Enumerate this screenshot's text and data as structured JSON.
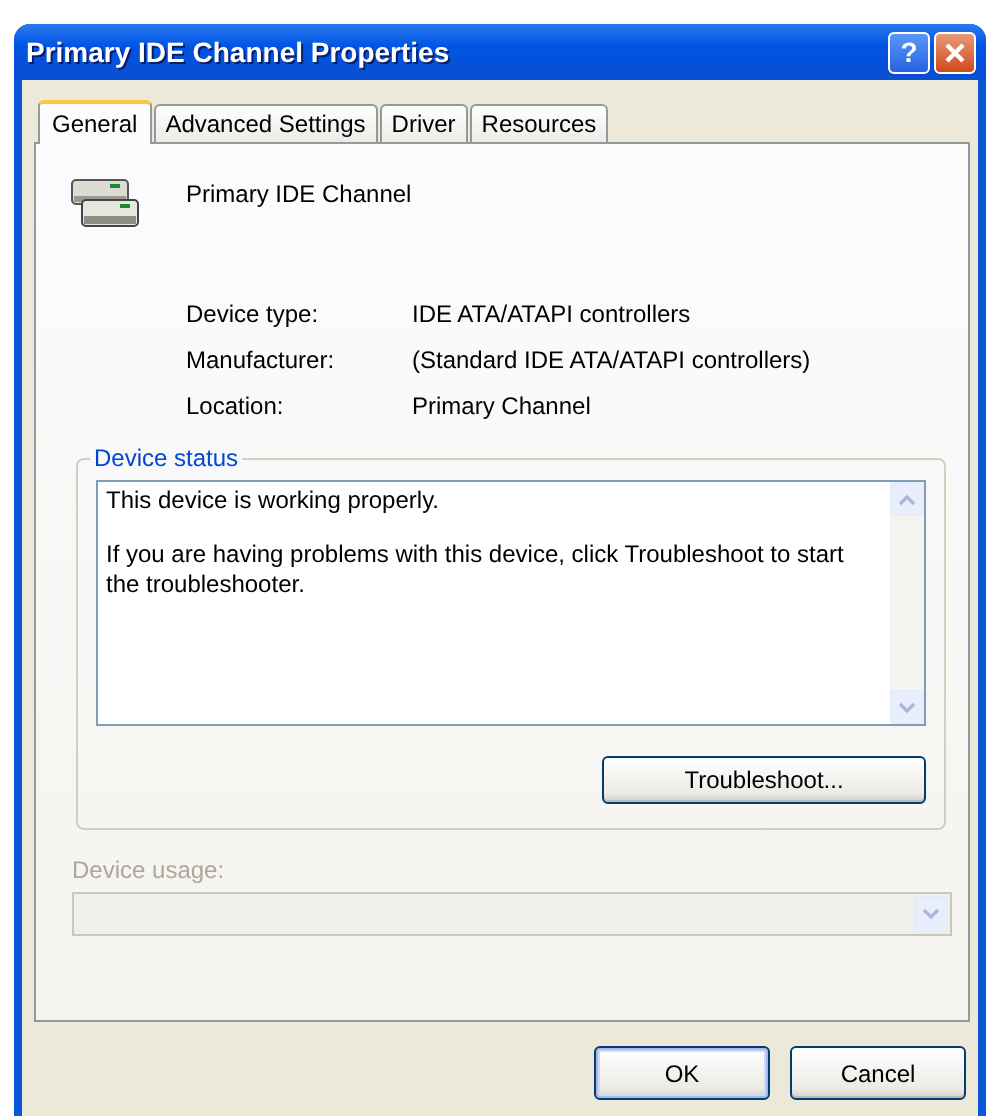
{
  "window": {
    "title": "Primary IDE Channel Properties",
    "help_button": "?"
  },
  "tabs": [
    {
      "label": "General",
      "selected": true
    },
    {
      "label": "Advanced Settings",
      "selected": false
    },
    {
      "label": "Driver",
      "selected": false
    },
    {
      "label": "Resources",
      "selected": false
    }
  ],
  "device": {
    "name": "Primary IDE Channel",
    "properties": [
      {
        "label": "Device type:",
        "value": "IDE ATA/ATAPI controllers"
      },
      {
        "label": "Manufacturer:",
        "value": "(Standard IDE ATA/ATAPI controllers)"
      },
      {
        "label": "Location:",
        "value": "Primary Channel"
      }
    ]
  },
  "device_status": {
    "title": "Device status",
    "message": [
      "This device is working properly.",
      "If you are having problems with this device, click Troubleshoot to start the troubleshooter."
    ],
    "button": "Troubleshoot..."
  },
  "device_usage": {
    "label": "Device usage:",
    "disabled": true
  },
  "buttons": [
    "OK",
    "Cancel"
  ]
}
